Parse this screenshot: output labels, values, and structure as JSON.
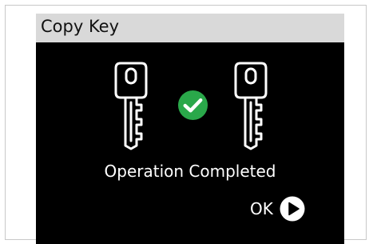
{
  "window": {
    "title": "Copy Key"
  },
  "status": {
    "message": "Operation Completed",
    "success_color": "#2aa84a"
  },
  "icons": {
    "source_key": "key-icon",
    "target_key": "key-icon",
    "status": "checkmark-circle-icon",
    "confirm": "play-circle-icon"
  },
  "actions": {
    "ok_label": "OK"
  }
}
